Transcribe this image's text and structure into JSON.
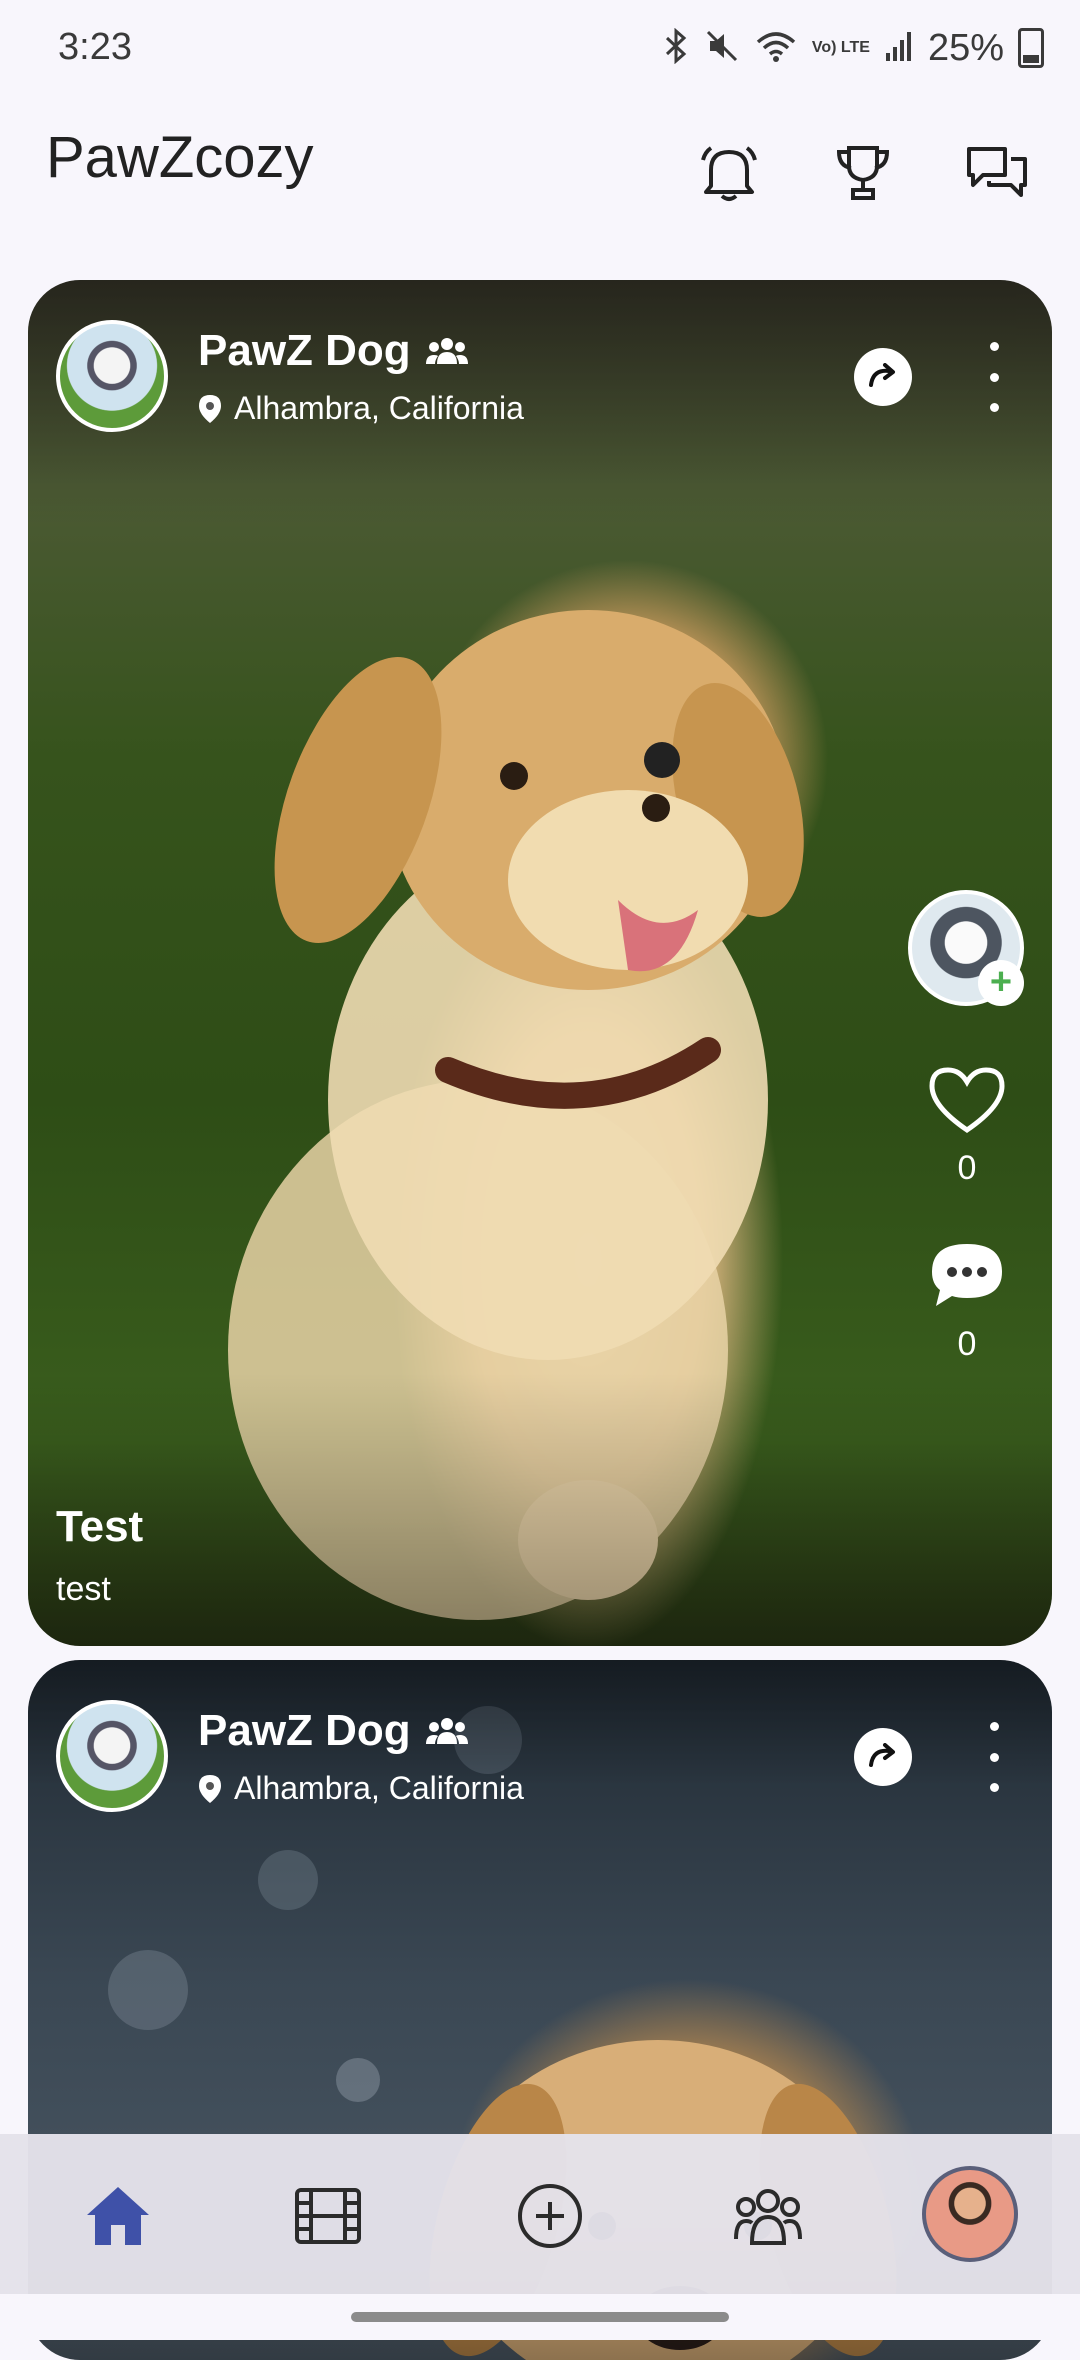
{
  "status_bar": {
    "time": "3:23",
    "battery": "25%",
    "volte": "Vo) LTE",
    "icons": [
      "bluetooth-icon",
      "mute-icon",
      "wifi-icon",
      "volte-icon",
      "signal-icon",
      "battery-icon"
    ]
  },
  "header": {
    "title": "PawZcozy",
    "actions": [
      "bell-icon",
      "trophy-icon",
      "chat-icon"
    ]
  },
  "posts": [
    {
      "author": "PawZ Dog",
      "location": "Alhambra, California",
      "likes": "0",
      "comments": "0",
      "caption_title": "Test",
      "caption_text": "test"
    },
    {
      "author": "PawZ Dog",
      "location": "Alhambra, California"
    }
  ],
  "bottom_nav": {
    "items": [
      "home-icon",
      "reels-icon",
      "add-post-icon",
      "community-icon",
      "profile-avatar"
    ],
    "active": "home",
    "active_color": "#3f51a8",
    "inactive_color": "#2b2b2b"
  }
}
